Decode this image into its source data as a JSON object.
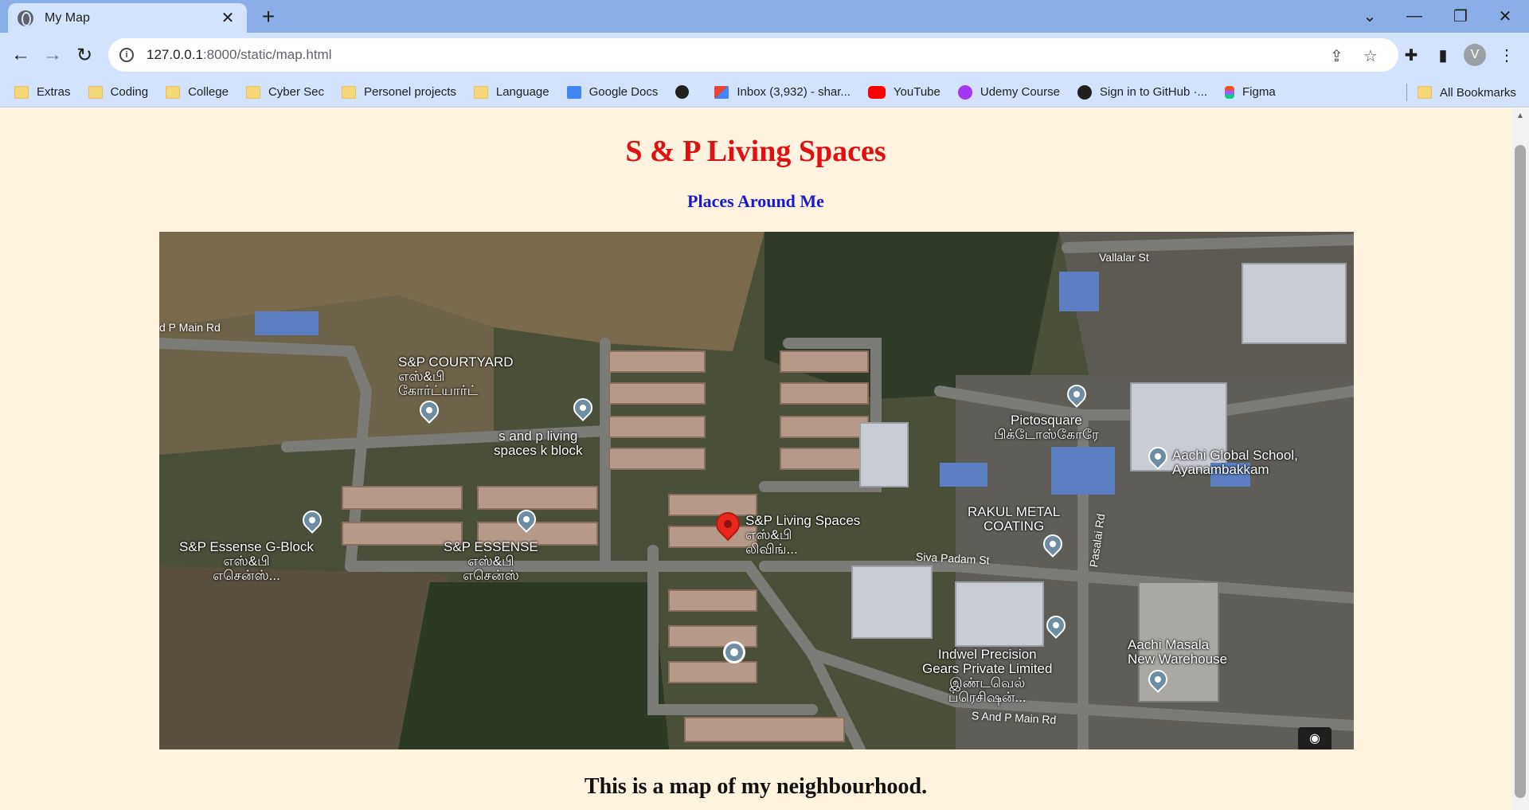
{
  "browser": {
    "tab_title": "My Map",
    "url_host": "127.0.0.1",
    "url_rest": ":8000/static/map.html",
    "profile_initial": "V",
    "bookmarks": [
      {
        "label": "Extras",
        "icon": "folder"
      },
      {
        "label": "Coding",
        "icon": "folder"
      },
      {
        "label": "College",
        "icon": "folder"
      },
      {
        "label": "Cyber Sec",
        "icon": "folder"
      },
      {
        "label": "Personel projects",
        "icon": "folder"
      },
      {
        "label": "Language",
        "icon": "folder"
      },
      {
        "label": "Google Docs",
        "icon": "docs"
      },
      {
        "label": "",
        "icon": "globe2"
      },
      {
        "label": "Inbox (3,932) - shar...",
        "icon": "gmail"
      },
      {
        "label": "YouTube",
        "icon": "yt"
      },
      {
        "label": "Udemy Course",
        "icon": "udemy"
      },
      {
        "label": "Sign in to GitHub ·...",
        "icon": "gh"
      },
      {
        "label": "Figma",
        "icon": "figma"
      }
    ],
    "all_bookmarks": "All Bookmarks"
  },
  "page": {
    "title": "S & P Living Spaces",
    "subtitle": "Places Around Me",
    "caption": "This is a map of my neighbourhood."
  },
  "map": {
    "places": [
      {
        "name": "S&P COURTYARD\nஎஸ்&பி\nகோர்ட்யார்ட்"
      },
      {
        "name": "s and p living\nspaces k block"
      },
      {
        "name": "S&P Essense G-Block\nஎஸ்&பி\nஎசென்ஸ்..."
      },
      {
        "name": "S&P ESSENSE\nஎஸ்&பி\nஎசென்ஸ்"
      },
      {
        "name": "S&P Living Spaces\nஎஸ்&பி\nலிவிங்..."
      },
      {
        "name": "Pictosquare\nபிக்டோஸ்கோரே"
      },
      {
        "name": "Aachi Global School,\nAyanambakkam"
      },
      {
        "name": "RAKUL METAL\nCOATING"
      },
      {
        "name": "Indwel Precision\nGears Private Limited\nஇண்டவெல்\nப்ரெசிஷன்..."
      },
      {
        "name": "Aachi Masala\nNew Warehouse"
      }
    ],
    "streets": [
      "Vallalar St",
      "d P Main Rd",
      "Siva Padam St",
      "Pasalai Rd",
      "S And P Main Rd"
    ]
  }
}
